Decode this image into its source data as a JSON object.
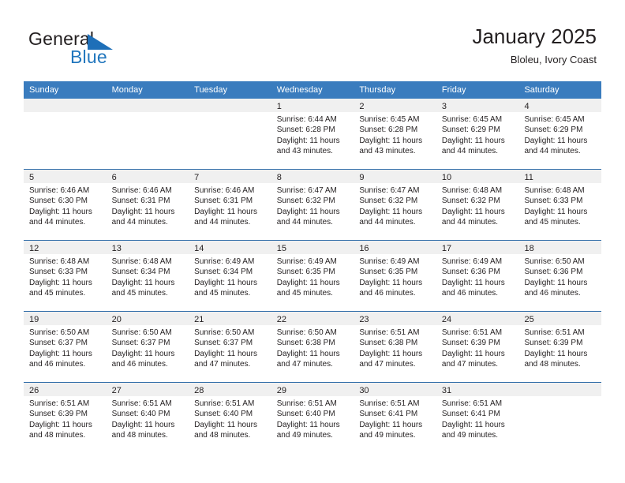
{
  "brand": {
    "name_part1": "General",
    "name_part2": "Blue",
    "flag_icon": "triangle-flag-icon"
  },
  "header": {
    "title": "January 2025",
    "subtitle": "Bloleu, Ivory Coast"
  },
  "colors": {
    "header_blue": "#3a7cbe",
    "brand_blue": "#2176bd",
    "day_band_grey": "#f0f0f0",
    "text": "#231f20"
  },
  "weekdays": [
    "Sunday",
    "Monday",
    "Tuesday",
    "Wednesday",
    "Thursday",
    "Friday",
    "Saturday"
  ],
  "weeks": [
    [
      {
        "day": "",
        "empty": true,
        "lines": []
      },
      {
        "day": "",
        "empty": true,
        "lines": []
      },
      {
        "day": "",
        "empty": true,
        "lines": []
      },
      {
        "day": "1",
        "empty": false,
        "lines": [
          "Sunrise: 6:44 AM",
          "Sunset: 6:28 PM",
          "Daylight: 11 hours",
          "and 43 minutes."
        ]
      },
      {
        "day": "2",
        "empty": false,
        "lines": [
          "Sunrise: 6:45 AM",
          "Sunset: 6:28 PM",
          "Daylight: 11 hours",
          "and 43 minutes."
        ]
      },
      {
        "day": "3",
        "empty": false,
        "lines": [
          "Sunrise: 6:45 AM",
          "Sunset: 6:29 PM",
          "Daylight: 11 hours",
          "and 44 minutes."
        ]
      },
      {
        "day": "4",
        "empty": false,
        "lines": [
          "Sunrise: 6:45 AM",
          "Sunset: 6:29 PM",
          "Daylight: 11 hours",
          "and 44 minutes."
        ]
      }
    ],
    [
      {
        "day": "5",
        "empty": false,
        "lines": [
          "Sunrise: 6:46 AM",
          "Sunset: 6:30 PM",
          "Daylight: 11 hours",
          "and 44 minutes."
        ]
      },
      {
        "day": "6",
        "empty": false,
        "lines": [
          "Sunrise: 6:46 AM",
          "Sunset: 6:31 PM",
          "Daylight: 11 hours",
          "and 44 minutes."
        ]
      },
      {
        "day": "7",
        "empty": false,
        "lines": [
          "Sunrise: 6:46 AM",
          "Sunset: 6:31 PM",
          "Daylight: 11 hours",
          "and 44 minutes."
        ]
      },
      {
        "day": "8",
        "empty": false,
        "lines": [
          "Sunrise: 6:47 AM",
          "Sunset: 6:32 PM",
          "Daylight: 11 hours",
          "and 44 minutes."
        ]
      },
      {
        "day": "9",
        "empty": false,
        "lines": [
          "Sunrise: 6:47 AM",
          "Sunset: 6:32 PM",
          "Daylight: 11 hours",
          "and 44 minutes."
        ]
      },
      {
        "day": "10",
        "empty": false,
        "lines": [
          "Sunrise: 6:48 AM",
          "Sunset: 6:32 PM",
          "Daylight: 11 hours",
          "and 44 minutes."
        ]
      },
      {
        "day": "11",
        "empty": false,
        "lines": [
          "Sunrise: 6:48 AM",
          "Sunset: 6:33 PM",
          "Daylight: 11 hours",
          "and 45 minutes."
        ]
      }
    ],
    [
      {
        "day": "12",
        "empty": false,
        "lines": [
          "Sunrise: 6:48 AM",
          "Sunset: 6:33 PM",
          "Daylight: 11 hours",
          "and 45 minutes."
        ]
      },
      {
        "day": "13",
        "empty": false,
        "lines": [
          "Sunrise: 6:48 AM",
          "Sunset: 6:34 PM",
          "Daylight: 11 hours",
          "and 45 minutes."
        ]
      },
      {
        "day": "14",
        "empty": false,
        "lines": [
          "Sunrise: 6:49 AM",
          "Sunset: 6:34 PM",
          "Daylight: 11 hours",
          "and 45 minutes."
        ]
      },
      {
        "day": "15",
        "empty": false,
        "lines": [
          "Sunrise: 6:49 AM",
          "Sunset: 6:35 PM",
          "Daylight: 11 hours",
          "and 45 minutes."
        ]
      },
      {
        "day": "16",
        "empty": false,
        "lines": [
          "Sunrise: 6:49 AM",
          "Sunset: 6:35 PM",
          "Daylight: 11 hours",
          "and 46 minutes."
        ]
      },
      {
        "day": "17",
        "empty": false,
        "lines": [
          "Sunrise: 6:49 AM",
          "Sunset: 6:36 PM",
          "Daylight: 11 hours",
          "and 46 minutes."
        ]
      },
      {
        "day": "18",
        "empty": false,
        "lines": [
          "Sunrise: 6:50 AM",
          "Sunset: 6:36 PM",
          "Daylight: 11 hours",
          "and 46 minutes."
        ]
      }
    ],
    [
      {
        "day": "19",
        "empty": false,
        "lines": [
          "Sunrise: 6:50 AM",
          "Sunset: 6:37 PM",
          "Daylight: 11 hours",
          "and 46 minutes."
        ]
      },
      {
        "day": "20",
        "empty": false,
        "lines": [
          "Sunrise: 6:50 AM",
          "Sunset: 6:37 PM",
          "Daylight: 11 hours",
          "and 46 minutes."
        ]
      },
      {
        "day": "21",
        "empty": false,
        "lines": [
          "Sunrise: 6:50 AM",
          "Sunset: 6:37 PM",
          "Daylight: 11 hours",
          "and 47 minutes."
        ]
      },
      {
        "day": "22",
        "empty": false,
        "lines": [
          "Sunrise: 6:50 AM",
          "Sunset: 6:38 PM",
          "Daylight: 11 hours",
          "and 47 minutes."
        ]
      },
      {
        "day": "23",
        "empty": false,
        "lines": [
          "Sunrise: 6:51 AM",
          "Sunset: 6:38 PM",
          "Daylight: 11 hours",
          "and 47 minutes."
        ]
      },
      {
        "day": "24",
        "empty": false,
        "lines": [
          "Sunrise: 6:51 AM",
          "Sunset: 6:39 PM",
          "Daylight: 11 hours",
          "and 47 minutes."
        ]
      },
      {
        "day": "25",
        "empty": false,
        "lines": [
          "Sunrise: 6:51 AM",
          "Sunset: 6:39 PM",
          "Daylight: 11 hours",
          "and 48 minutes."
        ]
      }
    ],
    [
      {
        "day": "26",
        "empty": false,
        "lines": [
          "Sunrise: 6:51 AM",
          "Sunset: 6:39 PM",
          "Daylight: 11 hours",
          "and 48 minutes."
        ]
      },
      {
        "day": "27",
        "empty": false,
        "lines": [
          "Sunrise: 6:51 AM",
          "Sunset: 6:40 PM",
          "Daylight: 11 hours",
          "and 48 minutes."
        ]
      },
      {
        "day": "28",
        "empty": false,
        "lines": [
          "Sunrise: 6:51 AM",
          "Sunset: 6:40 PM",
          "Daylight: 11 hours",
          "and 48 minutes."
        ]
      },
      {
        "day": "29",
        "empty": false,
        "lines": [
          "Sunrise: 6:51 AM",
          "Sunset: 6:40 PM",
          "Daylight: 11 hours",
          "and 49 minutes."
        ]
      },
      {
        "day": "30",
        "empty": false,
        "lines": [
          "Sunrise: 6:51 AM",
          "Sunset: 6:41 PM",
          "Daylight: 11 hours",
          "and 49 minutes."
        ]
      },
      {
        "day": "31",
        "empty": false,
        "lines": [
          "Sunrise: 6:51 AM",
          "Sunset: 6:41 PM",
          "Daylight: 11 hours",
          "and 49 minutes."
        ]
      },
      {
        "day": "",
        "empty": true,
        "lines": []
      }
    ]
  ]
}
